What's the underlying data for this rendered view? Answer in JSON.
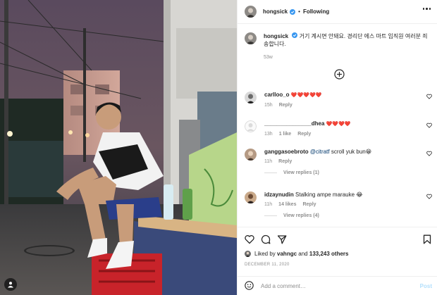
{
  "post": {
    "username": "hongsick",
    "follow_status": "Following",
    "dot": "•",
    "caption_text": "거기 계시면 안돼요. 경리단 에스 마트 임직원 여러분 죄송합니다.",
    "caption_time": "53w"
  },
  "comments": [
    {
      "username": "carlloo_o",
      "text": "❤️❤️❤️❤️❤️",
      "time": "15h",
      "likes": "",
      "reply": "Reply",
      "view_replies": ""
    },
    {
      "username": "_______________dhea",
      "text": "❤️❤️❤️❤️",
      "time": "13h",
      "likes": "1 like",
      "reply": "Reply",
      "view_replies": ""
    },
    {
      "username": "ganggasoebroto",
      "mention": "@citratf",
      "text": "scroll yuk bun😁",
      "time": "11h",
      "likes": "",
      "reply": "Reply",
      "view_replies": "View replies (1)"
    },
    {
      "username": "idzaynudin",
      "text": "Stalking ampe marauke 😂",
      "time": "11h",
      "likes": "14 likes",
      "reply": "Reply",
      "view_replies": "View replies (4)"
    }
  ],
  "likes": {
    "prefix": "Liked by",
    "user": "vahngc",
    "and": "and",
    "count": "133,243 others"
  },
  "date": "DECEMBER 11, 2020",
  "add_comment": {
    "placeholder": "Add a comment…",
    "post_label": "Post"
  },
  "icons": {
    "verified": "verified-badge-icon",
    "more": "more-options-icon",
    "load_more": "plus-circle-icon",
    "like": "heart-icon",
    "comment": "comment-icon",
    "share": "paper-plane-icon",
    "save": "bookmark-icon",
    "emoji": "smiley-icon",
    "tag": "user-tag-icon"
  },
  "colors": {
    "verified_blue": "#3897f0",
    "link": "#00376b",
    "muted": "#8e8e8e",
    "post_disabled": "#b2dffc"
  }
}
